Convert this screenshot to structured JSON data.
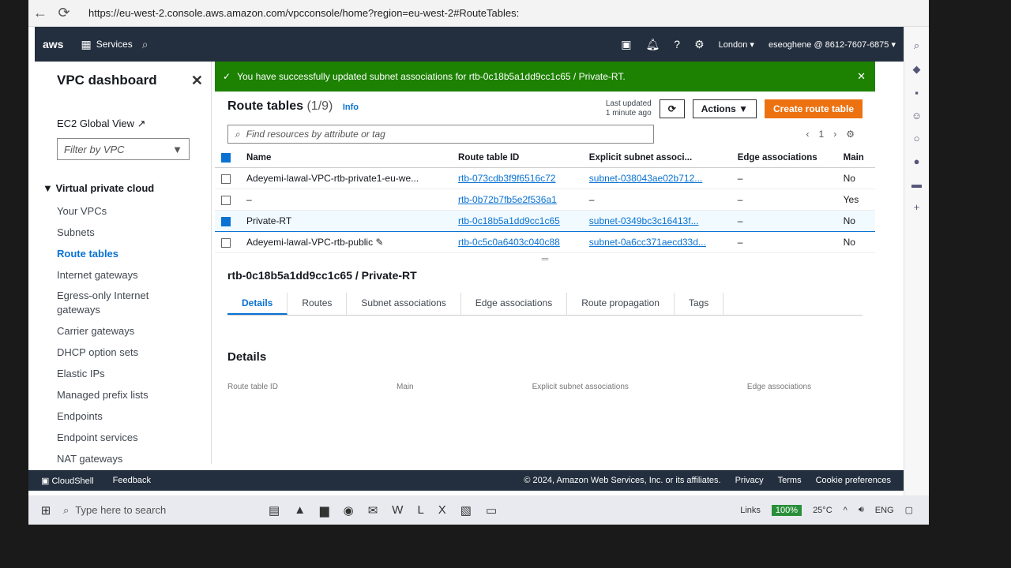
{
  "browser": {
    "url": "https://eu-west-2.console.aws.amazon.com/vpcconsole/home?region=eu-west-2#RouteTables:"
  },
  "awsnav": {
    "logo": "aws",
    "services": "Services",
    "region": "London ▾",
    "account": "eseoghene @ 8612-7607-6875 ▾"
  },
  "sidebar": {
    "title": "VPC dashboard",
    "ec2_global_view": "EC2 Global View",
    "filter_placeholder": "Filter by VPC",
    "section": "Virtual private cloud",
    "items": [
      "Your VPCs",
      "Subnets",
      "Route tables",
      "Internet gateways",
      "Egress-only Internet gateways",
      "Carrier gateways",
      "DHCP option sets",
      "Elastic IPs",
      "Managed prefix lists",
      "Endpoints",
      "Endpoint services",
      "NAT gateways"
    ]
  },
  "flash": {
    "message": "You have successfully updated subnet associations for rtb-0c18b5a1dd9cc1c65 / Private-RT."
  },
  "route_tables": {
    "title": "Route tables",
    "count": "(1/9)",
    "info": "Info",
    "last_updated": "Last updated",
    "last_updated_time": "1 minute ago",
    "actions": "Actions ▼",
    "create": "Create route table",
    "search_placeholder": "Find resources by attribute or tag",
    "page": "1",
    "columns": [
      "Name",
      "Route table ID",
      "Explicit subnet associ...",
      "Edge associations",
      "Main"
    ],
    "rows": [
      {
        "name": "Adeyemi-lawal-VPC-rtb-private1-eu-we...",
        "id": "rtb-073cdb3f9f6516c72",
        "subnet": "subnet-038043ae02b712...",
        "edge": "–",
        "main": "No"
      },
      {
        "name": "–",
        "id": "rtb-0b72b7fb5e2f536a1",
        "subnet": "–",
        "edge": "–",
        "main": "Yes"
      },
      {
        "name": "Private-RT",
        "id": "rtb-0c18b5a1dd9cc1c65",
        "subnet": "subnet-0349bc3c16413f...",
        "edge": "–",
        "main": "No"
      },
      {
        "name": "Adeyemi-lawal-VPC-rtb-public",
        "id": "rtb-0c5c0a6403c040c88",
        "subnet": "subnet-0a6cc371aecd33d...",
        "edge": "–",
        "main": "No"
      }
    ]
  },
  "detail": {
    "title": "rtb-0c18b5a1dd9cc1c65 / Private-RT",
    "tabs": [
      "Details",
      "Routes",
      "Subnet associations",
      "Edge associations",
      "Route propagation",
      "Tags"
    ],
    "panel_title": "Details",
    "cols": [
      "Route table ID",
      "Main",
      "Explicit subnet associations",
      "Edge associations"
    ]
  },
  "bottombar": {
    "cloudshell": "CloudShell",
    "feedback": "Feedback",
    "copyright": "© 2024, Amazon Web Services, Inc. or its affiliates.",
    "privacy": "Privacy",
    "terms": "Terms",
    "cookies": "Cookie preferences"
  },
  "taskbar": {
    "search": "Type here to search",
    "links": "Links",
    "zoom": "100%",
    "temp": "25°C",
    "lang": "ENG"
  }
}
